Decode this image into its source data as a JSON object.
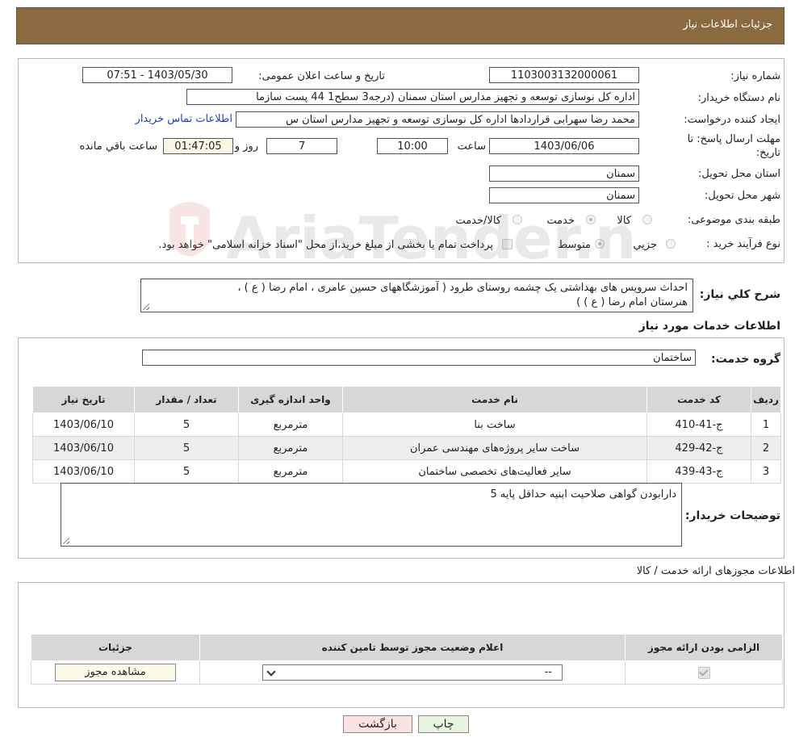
{
  "header": {
    "title": "جزئیات اطلاعات نیاز"
  },
  "form": {
    "need_number_label": "شماره نیاز:",
    "need_number": "1103003132000061",
    "announce_label": "تاریخ و ساعت اعلان عمومی:",
    "announce_value": "1403/05/30 - 07:51",
    "buyer_label": "نام دستگاه خریدار:",
    "buyer_value": "اداره کل نوسازی   توسعه و تجهیز مدارس استان سمنان (درجه3  سطح1  44 پست سازما",
    "creator_label": "ایجاد کننده درخواست:",
    "creator_value": "محمد رضا سهرابی قراردادها اداره کل نوسازی   توسعه و تجهیز مدارس استان س",
    "contact_link": "اطلاعات تماس خریدار",
    "deadline_label": "مهلت ارسال پاسخ: تا تاریخ:",
    "deadline_date": "1403/06/06",
    "time_label": "ساعت",
    "deadline_time": "10:00",
    "days_value": "7",
    "days_label": "روز و",
    "remaining_value": "01:47:05",
    "remaining_label": "ساعت باقي مانده",
    "province_label": "استان محل تحویل:",
    "province_value": "سمنان",
    "city_label": "شهر محل تحویل:",
    "city_value": "سمنان",
    "category_label": "طبقه بندی موضوعی:",
    "category_options": [
      "کالا",
      "خدمت",
      "کالا/خدمت"
    ],
    "category_selected": "خدمت",
    "process_label": "نوع فرآیند خرید :",
    "process_options": [
      "جزیي",
      "متوسط"
    ],
    "process_selected": "متوسط",
    "payment_text": "پرداخت تمام یا بخشی از مبلغ خرید،از محل \"اسناد خزانه اسلامی\" خواهد بود."
  },
  "description": {
    "label": "شرح کلي نياز:",
    "line1": "احداث سرویس های بهداشتی یک چشمه روستای طرود ( آموزشگاههای حسین عامری ، امام رضا ( ع ) ،",
    "line2": "هنرستان امام رضا ( ع ) )"
  },
  "services": {
    "section_title": "اطلاعات خدمات مورد نیاز",
    "group_label": "گروه خدمت:",
    "group_value": "ساختمان",
    "columns": [
      "ردیف",
      "کد خدمت",
      "نام خدمت",
      "واحد اندازه گیری",
      "تعداد / مقدار",
      "تاریخ نیاز"
    ],
    "rows": [
      {
        "idx": "1",
        "code": "ج-41-410",
        "name": "ساخت بنا",
        "unit": "مترمربع",
        "qty": "5",
        "date": "1403/06/10"
      },
      {
        "idx": "2",
        "code": "ج-42-429",
        "name": "ساخت سایر پروژه‌های مهندسی عمران",
        "unit": "مترمربع",
        "qty": "5",
        "date": "1403/06/10"
      },
      {
        "idx": "3",
        "code": "ج-43-439",
        "name": "سایر فعالیت‌های تخصصی ساختمان",
        "unit": "مترمربع",
        "qty": "5",
        "date": "1403/06/10"
      }
    ]
  },
  "buyer_notes": {
    "label": "توضیحات خریدار:",
    "text": "دارابودن گواهی صلاحیت ابنیه حداقل پایه 5"
  },
  "permits": {
    "section_title": "اطلاعات مجوزهای ارائه خدمت / کالا",
    "columns": [
      "الزامی بودن ارائه مجوز",
      "اعلام وضعیت مجوز توسط تامین کننده",
      "جزئیات"
    ],
    "select_value": "--",
    "view_button": "مشاهده مجوز"
  },
  "footer": {
    "print_button": "چاپ",
    "back_button": "بازگشت"
  },
  "watermark": {
    "text": "AriaTender.net"
  },
  "colors": {
    "header_bg": "#8b6a3f",
    "print_bg": "#e8f6e0",
    "back_bg": "#fbe3e3",
    "link": "#1a44c4"
  }
}
